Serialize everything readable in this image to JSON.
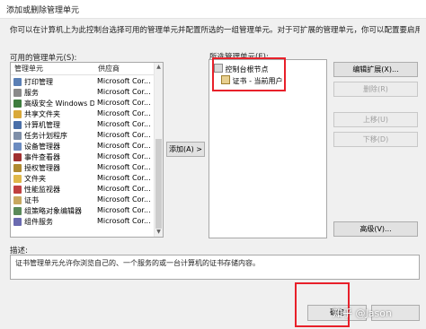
{
  "window": {
    "title": "添加或删除管理单元"
  },
  "description": "你可以在计算机上为此控制台选择可用的管理单元并配置所选的一组管理单元。对于可扩展的管理单元，你可以配置要启用哪些扩展。",
  "available": {
    "label": "可用的管理单元(S):",
    "columns": {
      "name": "管理单元",
      "vendor": "供应商"
    },
    "items": [
      {
        "name": "打印管理",
        "vendor": "Microsoft Cor...",
        "color": "#5a7fb5"
      },
      {
        "name": "服务",
        "vendor": "Microsoft Cor...",
        "color": "#8a8a8a"
      },
      {
        "name": "高级安全 Windows Def...",
        "vendor": "Microsoft Cor...",
        "color": "#3e7d3e"
      },
      {
        "name": "共享文件夹",
        "vendor": "Microsoft Cor...",
        "color": "#d9a93a"
      },
      {
        "name": "计算机管理",
        "vendor": "Microsoft Cor...",
        "color": "#4a6fa8"
      },
      {
        "name": "任务计划程序",
        "vendor": "Microsoft Cor...",
        "color": "#7f8fa8"
      },
      {
        "name": "设备管理器",
        "vendor": "Microsoft Cor...",
        "color": "#6c8cc0"
      },
      {
        "name": "事件查看器",
        "vendor": "Microsoft Cor...",
        "color": "#a03030"
      },
      {
        "name": "授权管理器",
        "vendor": "Microsoft Cor...",
        "color": "#b08a30"
      },
      {
        "name": "文件夹",
        "vendor": "Microsoft Cor...",
        "color": "#e0b84a"
      },
      {
        "name": "性能监视器",
        "vendor": "Microsoft Cor...",
        "color": "#c04040"
      },
      {
        "name": "证书",
        "vendor": "Microsoft Cor...",
        "color": "#c8a860"
      },
      {
        "name": "组策略对象编辑器",
        "vendor": "Microsoft Cor...",
        "color": "#5a8a5a"
      },
      {
        "name": "组件服务",
        "vendor": "Microsoft Cor...",
        "color": "#6a6ab0"
      }
    ]
  },
  "add_button": "添加(A) >",
  "selected": {
    "label": "所选管理单元(E):",
    "root": "控制台根节点",
    "child": "证书 - 当前用户"
  },
  "side_buttons": {
    "edit_ext": "编辑扩展(X)...",
    "remove": "删除(R)",
    "move_up": "上移(U)",
    "move_down": "下移(D)",
    "advanced": "高级(V)..."
  },
  "desc_section": {
    "label": "描述:",
    "text": "证书管理单元允许你浏览自己的、一个服务的或一台计算机的证书存储内容。"
  },
  "ok_button": "确定",
  "watermark": "知乎 @Jason"
}
